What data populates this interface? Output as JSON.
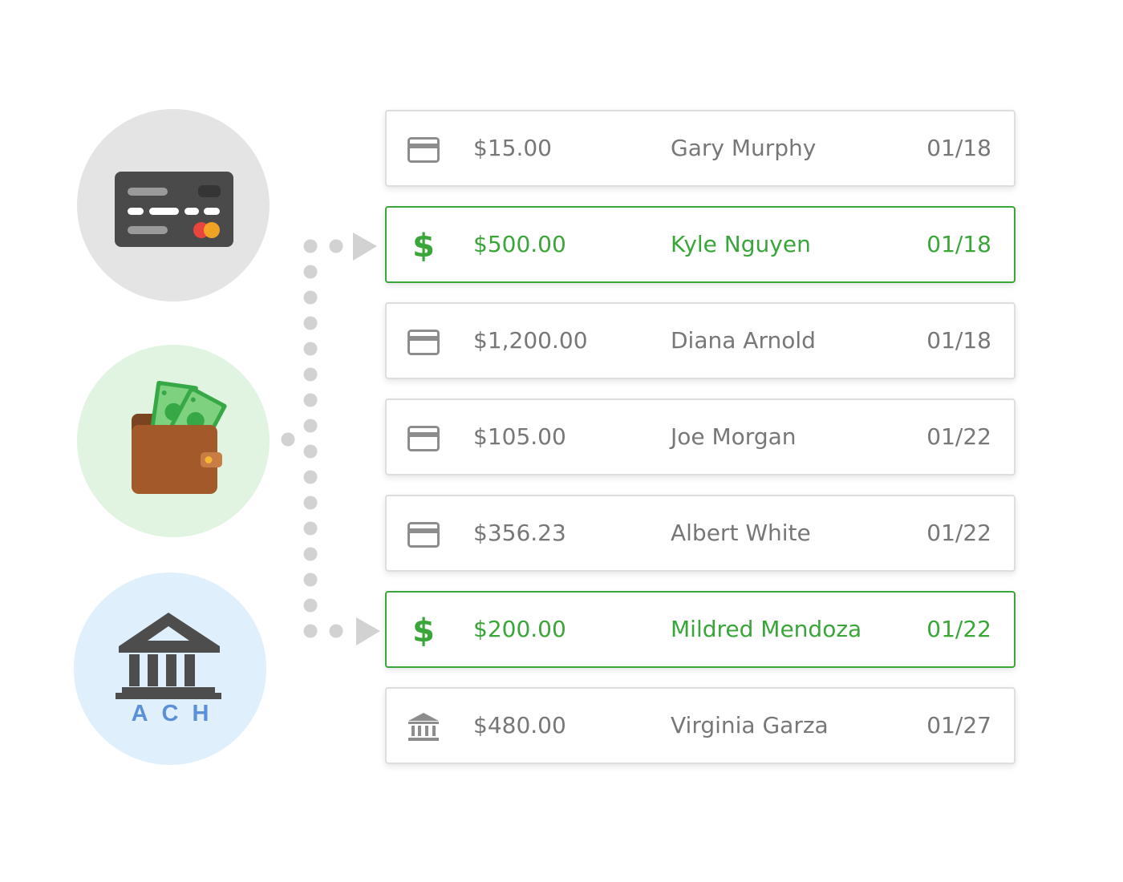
{
  "payment_methods": [
    {
      "kind": "card",
      "icon": "credit-card-icon"
    },
    {
      "kind": "cash",
      "icon": "wallet-cash-icon"
    },
    {
      "kind": "ach",
      "icon": "bank-icon",
      "label": "ACH"
    }
  ],
  "transactions": [
    {
      "icon": "card-icon",
      "amount": "$15.00",
      "name": "Gary Murphy",
      "date": "01/18",
      "highlight": false
    },
    {
      "icon": "dollar-icon",
      "amount": "$500.00",
      "name": "Kyle Nguyen",
      "date": "01/18",
      "highlight": true
    },
    {
      "icon": "card-icon",
      "amount": "$1,200.00",
      "name": "Diana Arnold",
      "date": "01/18",
      "highlight": false
    },
    {
      "icon": "card-icon",
      "amount": "$105.00",
      "name": "Joe Morgan",
      "date": "01/22",
      "highlight": false
    },
    {
      "icon": "card-icon",
      "amount": "$356.23",
      "name": "Albert White",
      "date": "01/22",
      "highlight": false
    },
    {
      "icon": "dollar-icon",
      "amount": "$200.00",
      "name": "Mildred Mendoza",
      "date": "01/22",
      "highlight": true
    },
    {
      "icon": "bank-icon",
      "amount": "$480.00",
      "name": "Virginia Garza",
      "date": "01/27",
      "highlight": false
    }
  ],
  "dollar_symbol": "$",
  "colors": {
    "highlight": "#3aa63a",
    "text": "#777777",
    "border": "#dedede",
    "card_bg": "#e4e4e4",
    "cash_bg": "#e1f4e1",
    "ach_bg": "#dff0fc",
    "ach_text": "#5b8fd8",
    "connector": "#d2d2d2"
  }
}
